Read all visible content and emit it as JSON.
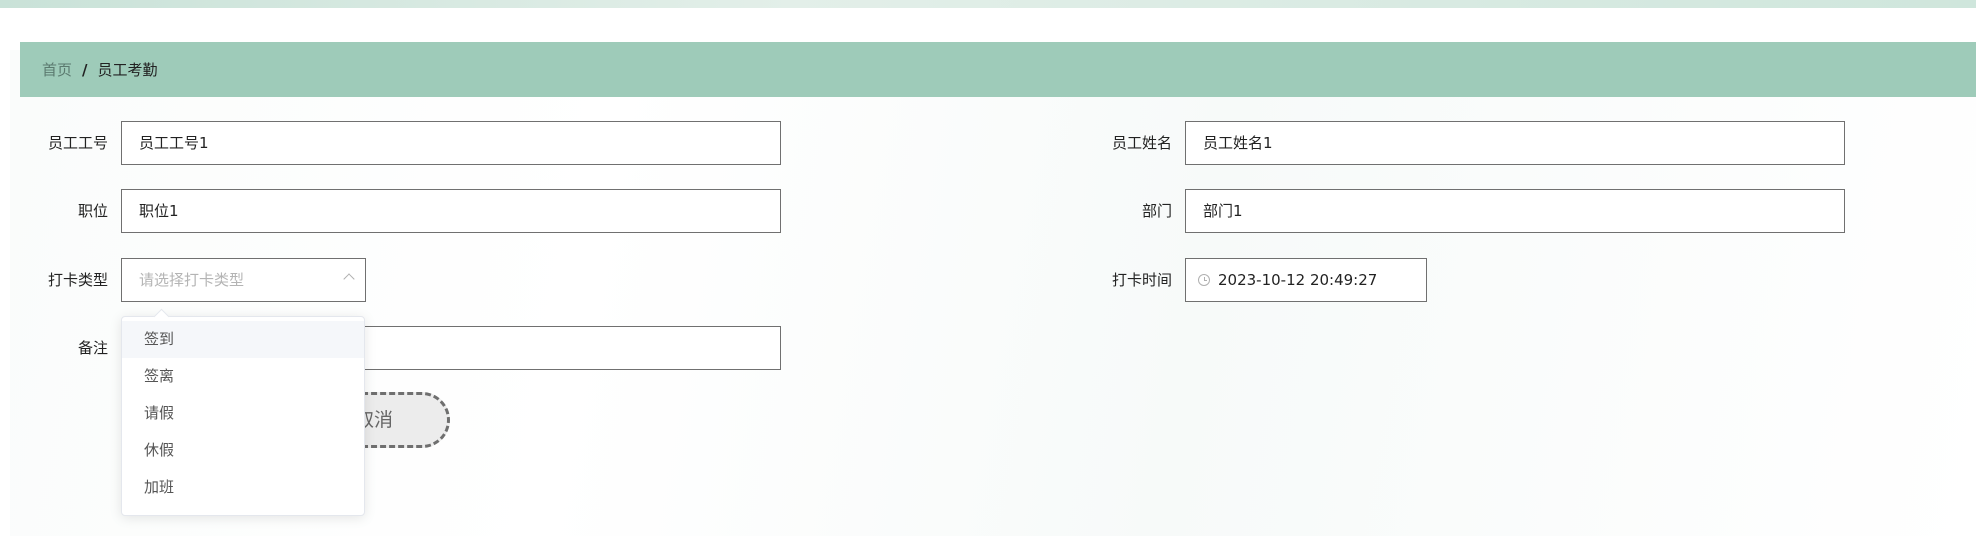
{
  "breadcrumb": {
    "home": "首页",
    "separator": "/",
    "current": "员工考勤"
  },
  "form": {
    "employee_id": {
      "label": "员工工号",
      "value": "员工工号1"
    },
    "employee_name": {
      "label": "员工姓名",
      "value": "员工姓名1"
    },
    "position": {
      "label": "职位",
      "value": "职位1"
    },
    "department": {
      "label": "部门",
      "value": "部门1"
    },
    "punch_type": {
      "label": "打卡类型",
      "placeholder": "请选择打卡类型"
    },
    "punch_time": {
      "label": "打卡时间",
      "value": "2023-10-12 20:49:27"
    },
    "remark": {
      "label": "备注",
      "value": ""
    }
  },
  "buttons": {
    "cancel": "取消"
  },
  "dropdown": {
    "options": [
      "签到",
      "签离",
      "请假",
      "休假",
      "加班"
    ]
  },
  "colors": {
    "breadcrumb_bg": "#9ecbb9",
    "accent_strip": "#c9e2d8"
  }
}
